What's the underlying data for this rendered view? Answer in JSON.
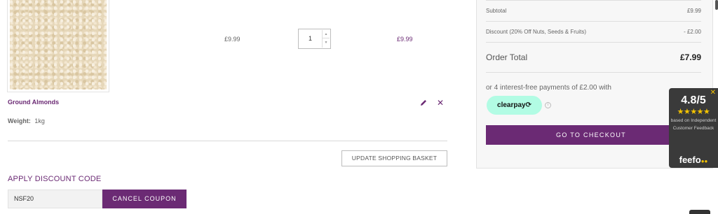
{
  "cart": {
    "item": {
      "name": "Ground Almonds",
      "weight_label": "Weight:",
      "weight_value": "1kg",
      "price": "£9.99",
      "quantity": "1",
      "line_total": "£9.99",
      "edit_icon": "pencil-icon",
      "remove_icon": "close-icon",
      "remove_glyph": "✕"
    },
    "update_button_label": "UPDATE SHOPPING BASKET"
  },
  "discount": {
    "title": "APPLY DISCOUNT CODE",
    "code": "NSF20",
    "cancel_label": "CANCEL COUPON"
  },
  "summary": {
    "subtotal_label": "Subtotal",
    "subtotal_value": "£9.99",
    "discount_label": "Discount (20% Off Nuts, Seeds & Fruits)",
    "discount_value": "- £2.00",
    "order_total_label": "Order Total",
    "order_total_value": "£7.99",
    "installments_text": "or 4 interest-free payments of £2.00 with",
    "clearpay_label": "clearpay⟳",
    "info_glyph": "i",
    "checkout_label": "GO TO CHECKOUT"
  },
  "feefo": {
    "close_glyph": "✕",
    "score": "4.8/5",
    "stars": "★★★★★",
    "rating_stars": 5,
    "based_on": "based on Independent Customer Feedback",
    "logo": "feefo",
    "logo_dots": "●●"
  },
  "colors": {
    "brand_purple": "#6b2a74",
    "clearpay_mint": "#b2fce4",
    "feefo_star": "#f5c400"
  }
}
